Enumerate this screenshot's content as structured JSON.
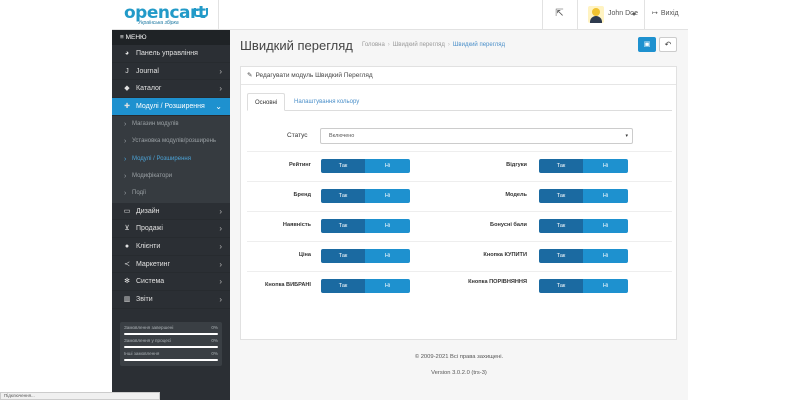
{
  "header": {
    "logo_text": "opencart",
    "logo_sub": "Українська збірка",
    "user_name": "John Doe",
    "logout_label": "Вихід"
  },
  "sidebar": {
    "menu_label": "≡ МЕНЮ",
    "items": [
      {
        "label": "Панель управління",
        "icon": "dashboard-icon"
      },
      {
        "label": "Journal",
        "icon": "journal-icon"
      },
      {
        "label": "Каталог",
        "icon": "tag-icon"
      },
      {
        "label": "Модулі / Розширення",
        "icon": "puzzle-icon"
      },
      {
        "label": "Дизайн",
        "icon": "monitor-icon"
      },
      {
        "label": "Продажі",
        "icon": "cart-icon"
      },
      {
        "label": "Клієнти",
        "icon": "user-icon"
      },
      {
        "label": "Маркетинг",
        "icon": "share-icon"
      },
      {
        "label": "Система",
        "icon": "gear-icon"
      },
      {
        "label": "Звіти",
        "icon": "chart-icon"
      }
    ],
    "subitems": [
      "Магазин модулів",
      "Установка модулів/розширень",
      "Модулі / Розширення",
      "Модифікатори",
      "Події"
    ],
    "stats": [
      {
        "label": "Замовлення завершені",
        "value": "0%"
      },
      {
        "label": "Замовлення у процесі",
        "value": "0%"
      },
      {
        "label": "Інші замовлення",
        "value": "0%"
      }
    ]
  },
  "page": {
    "title": "Швидкий перегляд",
    "breadcrumb": [
      "Головна",
      "Швидкий перегляд",
      "Швидкий перегляд"
    ]
  },
  "panel": {
    "heading": "Редагувати модуль Швидкий Перегляд",
    "tabs": [
      "Основні",
      "Налаштування кольору"
    ],
    "status_label": "Статус",
    "status_value": "Включено",
    "yes_label": "Так",
    "no_label": "Ні",
    "fields_left": [
      "Рейтинг",
      "Бренд",
      "Наявність",
      "Ціна",
      "Кнопка ВИБРАНІ"
    ],
    "fields_right": [
      "Відгуки",
      "Модель",
      "Бонусні бали",
      "Кнопка КУПИТИ",
      "Кнопка ПОРІВНЯННЯ"
    ]
  },
  "footer": {
    "copyright": "© 2009-2021 Всі права захищені.",
    "version": "Version 3.0.2.0 (trs-3)"
  },
  "statusbar": "Підключення..."
}
